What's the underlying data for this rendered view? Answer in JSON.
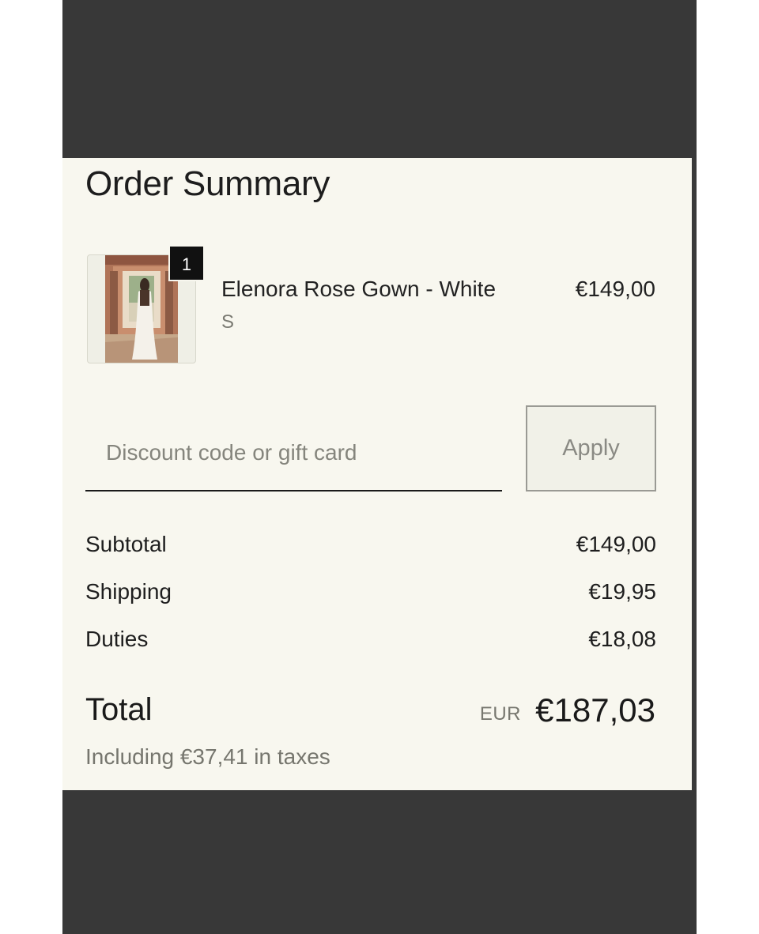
{
  "order_summary": {
    "title": "Order Summary",
    "item": {
      "quantity": "1",
      "name": "Elenora Rose Gown - White",
      "variant": "S",
      "price": "€149,00"
    },
    "discount": {
      "placeholder": "Discount code or gift card",
      "value": "",
      "apply_label": "Apply"
    },
    "rows": [
      {
        "label": "Subtotal",
        "value": "€149,00"
      },
      {
        "label": "Shipping",
        "value": "€19,95"
      },
      {
        "label": "Duties",
        "value": "€18,08"
      }
    ],
    "total": {
      "label": "Total",
      "currency": "EUR",
      "value": "€187,03",
      "tax_note": "Including €37,41 in taxes"
    }
  },
  "colors": {
    "panel_background": "#f8f7ef",
    "frame_background": "#383838",
    "badge_background": "#111111",
    "muted_text": "#77776f"
  }
}
